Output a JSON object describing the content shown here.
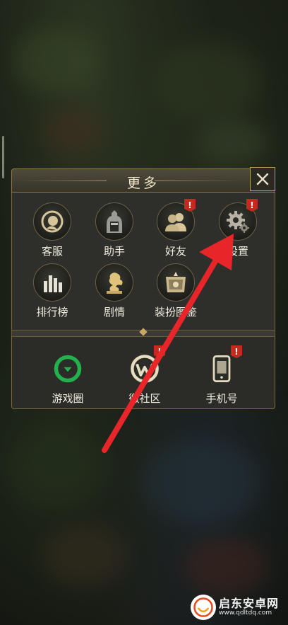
{
  "modal": {
    "title": "更多",
    "top_row1": [
      {
        "label": "客服",
        "icon": "customer-service-icon",
        "badge": ""
      },
      {
        "label": "助手",
        "icon": "assistant-icon",
        "badge": ""
      },
      {
        "label": "好友",
        "icon": "friends-icon",
        "badge": "!"
      },
      {
        "label": "设置",
        "icon": "settings-gear-icon",
        "badge": "!"
      }
    ],
    "top_row2": [
      {
        "label": "排行榜",
        "icon": "leaderboard-icon"
      },
      {
        "label": "剧情",
        "icon": "dragon-story-icon"
      },
      {
        "label": "装扮图鉴",
        "icon": "outfit-catalog-icon"
      }
    ],
    "bottom_row": [
      {
        "label": "游戏圈",
        "icon": "game-circle-icon",
        "badge": ""
      },
      {
        "label": "微社区",
        "icon": "micro-community-icon",
        "badge": "!"
      },
      {
        "label": "手机号",
        "icon": "phone-number-icon",
        "badge": "!"
      }
    ]
  },
  "watermark": {
    "name": "启东安卓网",
    "url": "www.qdltdq.com"
  },
  "colors": {
    "accent_gold": "#c9a865",
    "badge_red": "#c52a1f",
    "annotation_arrow": "#e8262a",
    "game_circle_green": "#22b14c"
  }
}
